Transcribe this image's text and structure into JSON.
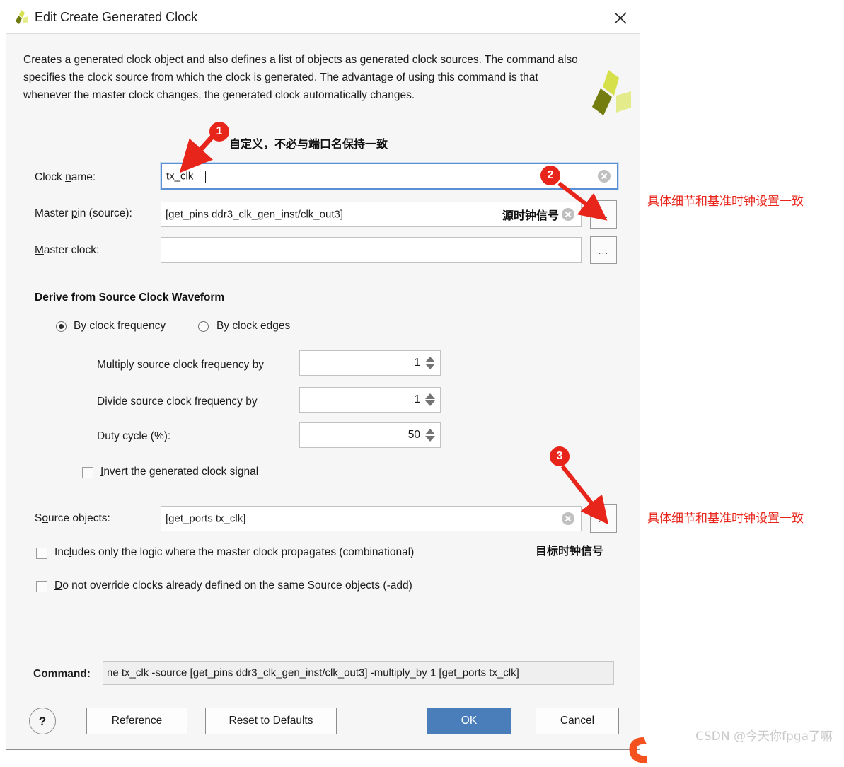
{
  "window": {
    "title": "Edit Create Generated Clock",
    "logo_icon": "vivado-logo-icon",
    "close_icon": "close-icon"
  },
  "description": "Creates a generated clock object and also defines a list of objects as generated clock sources. The command also specifies the clock source from which the clock is generated. The advantage of using this command is that whenever the master clock changes, the generated clock automatically changes.",
  "fields": {
    "clock_name": {
      "label": "Clock name:",
      "value": "tx_clk",
      "placeholder": "",
      "focused": true,
      "clear_icon": "clear-circle-icon"
    },
    "master_pin": {
      "label": "Master pin (source):",
      "value": "[get_pins ddr3_clk_gen_inst/clk_out3]",
      "placeholder": "",
      "browse_label": "...",
      "clear_icon": "clear-circle-icon"
    },
    "master_clock": {
      "label": "Master clock:",
      "value": "",
      "placeholder": "",
      "browse_label": "..."
    },
    "source_objects": {
      "label": "Source objects:",
      "value": "[get_ports tx_clk]",
      "placeholder": "",
      "browse_label": "...",
      "clear_icon": "clear-circle-icon"
    }
  },
  "group": {
    "title": "Derive from Source Clock Waveform",
    "radios": [
      {
        "label": "By clock frequency",
        "selected": true
      },
      {
        "label": "By clock edges",
        "selected": false
      }
    ],
    "spinners": [
      {
        "label": "Multiply source clock frequency by",
        "value": "1"
      },
      {
        "label": "Divide source clock frequency by",
        "value": "1"
      },
      {
        "label": "Duty cycle (%):",
        "value": "50"
      }
    ],
    "invert_checkbox": {
      "label": "Invert the generated clock signal",
      "checked": false
    }
  },
  "checkboxes": [
    {
      "label": "Includes only the logic where the master clock propagates (combinational)",
      "checked": false
    },
    {
      "label": "Do not override clocks already defined on the same Source objects (-add)",
      "checked": false
    }
  ],
  "command": {
    "label": "Command:",
    "value": "ne tx_clk -source [get_pins ddr3_clk_gen_inst/clk_out3] -multiply_by 1 [get_ports tx_clk]"
  },
  "buttons": {
    "help": "?",
    "reference": "Reference",
    "reset": "Reset to Defaults",
    "ok": "OK",
    "cancel": "Cancel"
  },
  "annotations": {
    "badges": [
      "1",
      "2",
      "3"
    ],
    "note_clock_name": "自定义，不必与端口名保持一致",
    "note_master_pin": "源时钟信号",
    "note_source_objects": "目标时钟信号",
    "note_right_top": "具体细节和基准时钟设置一致",
    "note_right_bottom": "具体细节和基准时钟设置一致",
    "accent_color": "#e8251b"
  },
  "watermark": "CSDN @今天你fpga了嘛"
}
